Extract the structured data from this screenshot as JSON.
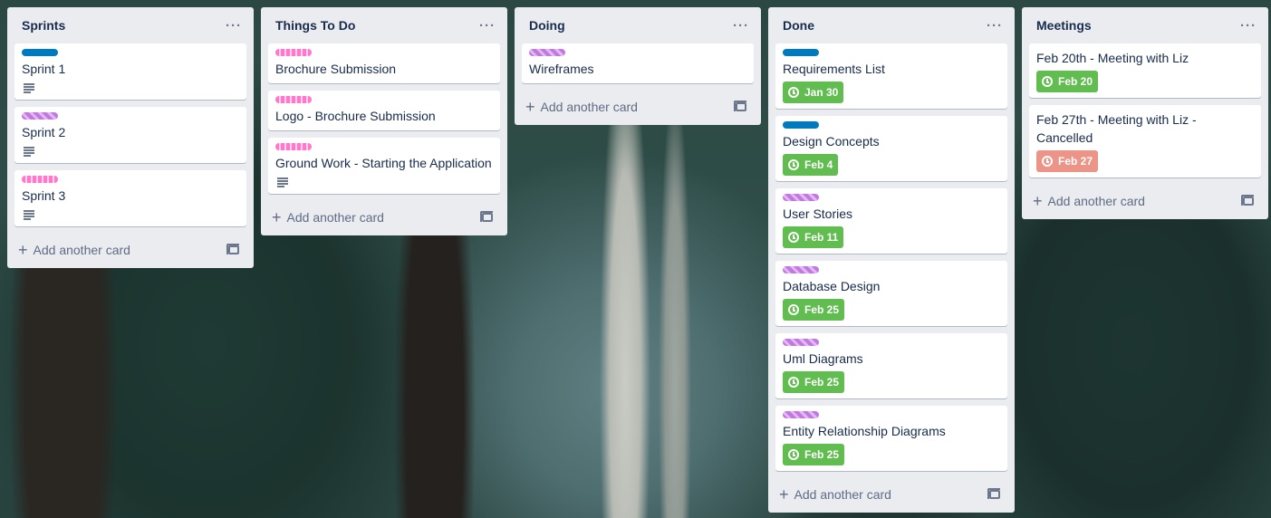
{
  "add_card_label": "Add another card",
  "lists": [
    {
      "title": "Sprints",
      "cards": [
        {
          "title": "Sprint 1",
          "label": "blue",
          "description": true
        },
        {
          "title": "Sprint 2",
          "label": "purple",
          "description": true
        },
        {
          "title": "Sprint 3",
          "label": "pink",
          "description": true
        }
      ]
    },
    {
      "title": "Things To Do",
      "cards": [
        {
          "title": "Brochure Submission",
          "label": "pink"
        },
        {
          "title": "Logo - Brochure Submission",
          "label": "pink"
        },
        {
          "title": "Ground Work - Starting the Application",
          "label": "pink",
          "description": true
        }
      ]
    },
    {
      "title": "Doing",
      "cards": [
        {
          "title": "Wireframes",
          "label": "purple"
        }
      ]
    },
    {
      "title": "Done",
      "cards": [
        {
          "title": "Requirements List",
          "label": "blue",
          "due": "Jan 30",
          "due_status": "complete"
        },
        {
          "title": "Design Concepts",
          "label": "blue",
          "due": "Feb 4",
          "due_status": "complete"
        },
        {
          "title": "User Stories",
          "label": "purple",
          "due": "Feb 11",
          "due_status": "complete"
        },
        {
          "title": "Database Design",
          "label": "purple",
          "due": "Feb 25",
          "due_status": "complete"
        },
        {
          "title": "Uml Diagrams",
          "label": "purple",
          "due": "Feb 25",
          "due_status": "complete"
        },
        {
          "title": "Entity Relationship Diagrams",
          "label": "purple",
          "due": "Feb 25",
          "due_status": "complete"
        }
      ]
    },
    {
      "title": "Meetings",
      "cards": [
        {
          "title": "Feb 20th - Meeting with Liz",
          "due": "Feb 20",
          "due_status": "complete"
        },
        {
          "title": "Feb 27th - Meeting with Liz - Cancelled",
          "due": "Feb 27",
          "due_status": "overdue"
        }
      ]
    }
  ],
  "colors": {
    "list_bg": "#ebecf0",
    "label_blue": "#0079bf",
    "label_purple": "#c377e0",
    "label_pink": "#ff78cb",
    "due_complete": "#61bd4f",
    "due_overdue": "#ec9488"
  }
}
